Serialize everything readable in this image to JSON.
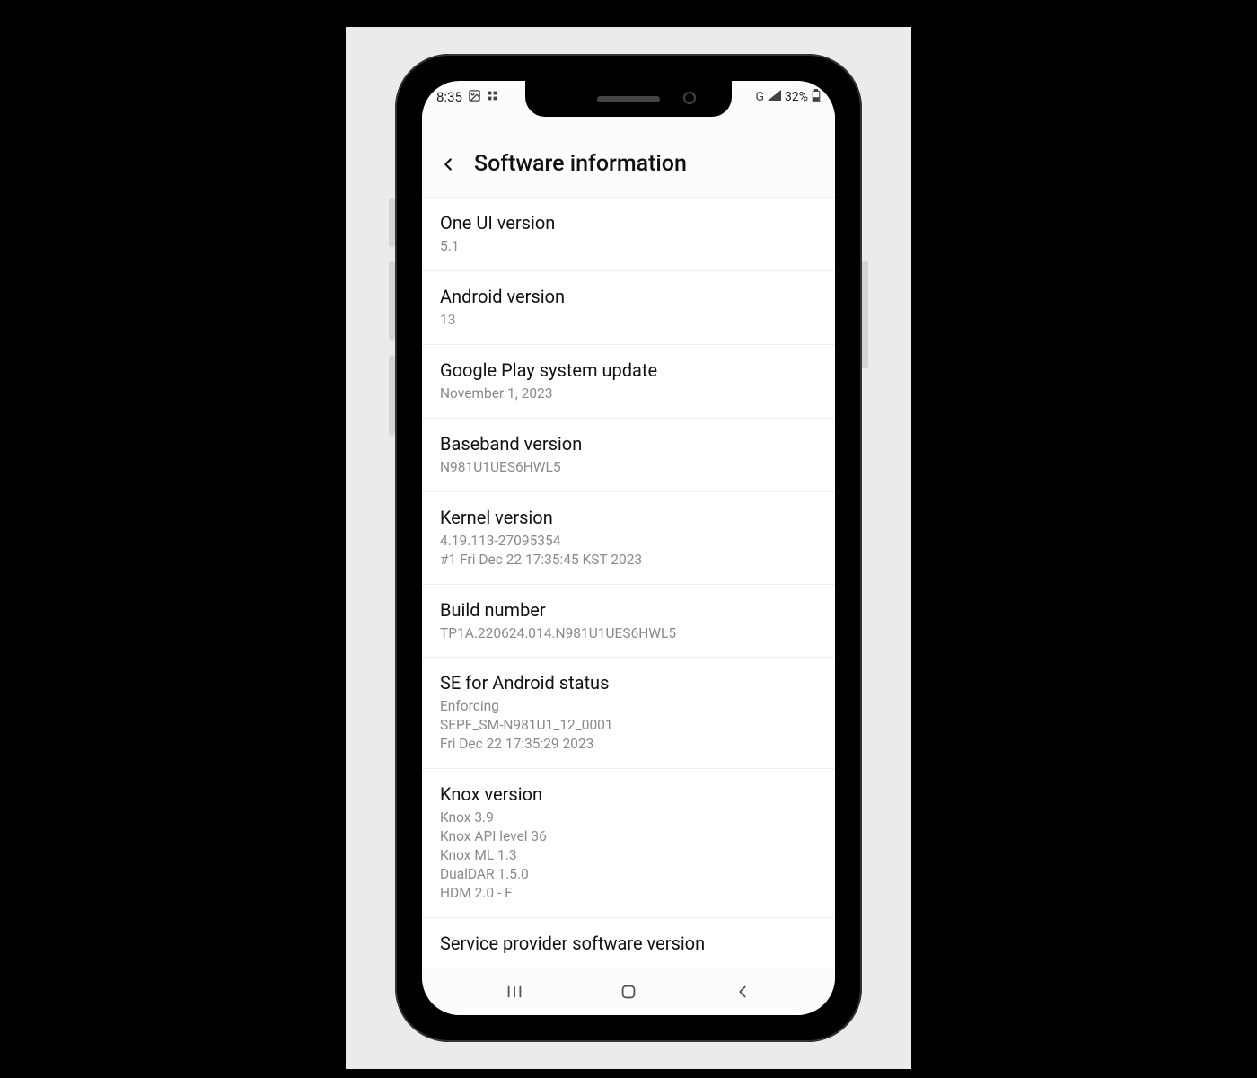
{
  "status": {
    "time": "8:35",
    "left_icons": [
      "image-icon",
      "apps-icon"
    ],
    "network": "G",
    "signal": "▮",
    "battery_pct": "32%"
  },
  "header": {
    "title": "Software information"
  },
  "rows": [
    {
      "label": "One UI version",
      "value": "5.1"
    },
    {
      "label": "Android version",
      "value": "13"
    },
    {
      "label": "Google Play system update",
      "value": "November 1, 2023"
    },
    {
      "label": "Baseband version",
      "value": "N981U1UES6HWL5"
    },
    {
      "label": "Kernel version",
      "value": "4.19.113-27095354\n#1 Fri Dec 22 17:35:45 KST 2023"
    },
    {
      "label": "Build number",
      "value": "TP1A.220624.014.N981U1UES6HWL5"
    },
    {
      "label": "SE for Android status",
      "value": "Enforcing\nSEPF_SM-N981U1_12_0001\nFri Dec 22 17:35:29 2023"
    },
    {
      "label": "Knox version",
      "value": "Knox 3.9\nKnox API level 36\nKnox ML 1.3\nDualDAR 1.5.0\nHDM 2.0 - F"
    },
    {
      "label": "Service provider software version",
      "value": ""
    }
  ]
}
